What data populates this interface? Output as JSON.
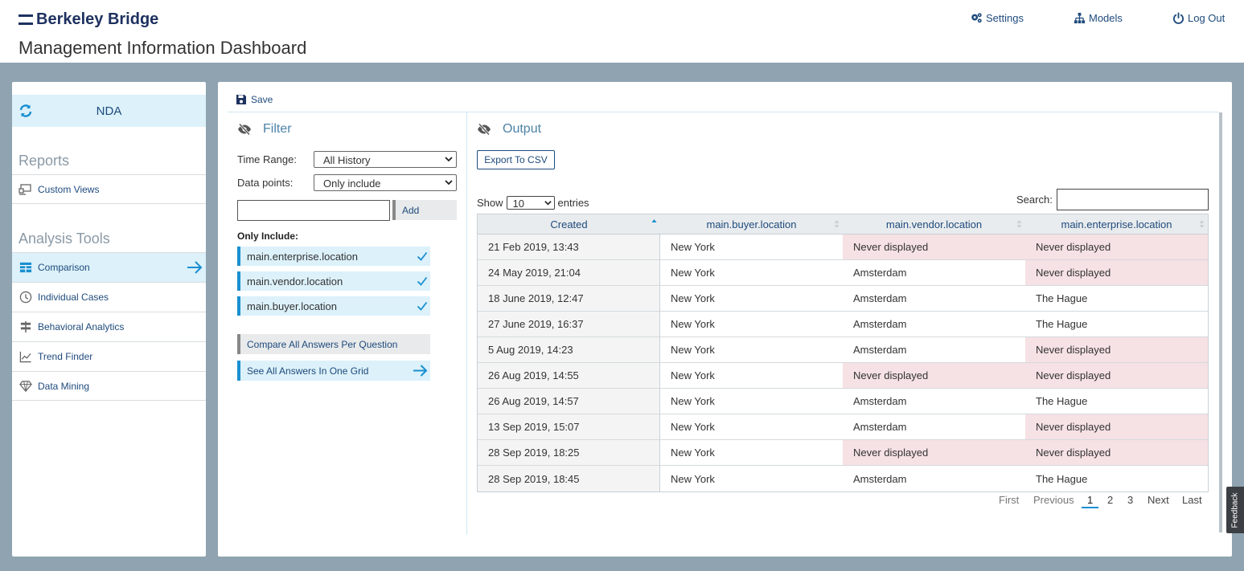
{
  "header": {
    "brand": "Berkeley Bridge",
    "title": "Management Information Dashboard",
    "nav": [
      {
        "label": "Settings",
        "icon": "gears-icon"
      },
      {
        "label": "Models",
        "icon": "sitemap-icon"
      },
      {
        "label": "Log Out",
        "icon": "power-icon"
      }
    ]
  },
  "sidebar": {
    "model": "NDA",
    "reports_title": "Reports",
    "reports": [
      {
        "label": "Custom Views",
        "icon": "custom-views-icon"
      }
    ],
    "tools_title": "Analysis Tools",
    "tools": [
      {
        "label": "Comparison",
        "icon": "table-icon",
        "active": true
      },
      {
        "label": "Individual Cases",
        "icon": "clock-icon"
      },
      {
        "label": "Behavioral Analytics",
        "icon": "signpost-icon"
      },
      {
        "label": "Trend Finder",
        "icon": "chart-line-icon"
      },
      {
        "label": "Data Mining",
        "icon": "diamond-icon"
      }
    ]
  },
  "toolbar": {
    "save_label": "Save"
  },
  "filter": {
    "title": "Filter",
    "time_range_label": "Time Range:",
    "time_range_value": "All History",
    "data_points_label": "Data points:",
    "data_points_value": "Only include",
    "add_input_value": "",
    "add_label": "Add",
    "only_include_label": "Only Include:",
    "included": [
      "main.enterprise.location",
      "main.vendor.location",
      "main.buyer.location"
    ],
    "compare_label": "Compare All Answers Per Question",
    "grid_label": "See All Answers In One Grid"
  },
  "output": {
    "title": "Output",
    "export_label": "Export To CSV",
    "show_label": "Show",
    "show_value": "10",
    "entries_label": "entries",
    "search_label": "Search:",
    "search_value": "",
    "columns": [
      "Created",
      "main.buyer.location",
      "main.vendor.location",
      "main.enterprise.location"
    ],
    "rows": [
      [
        "21 Feb 2019, 13:43",
        "New York",
        "Never displayed",
        "Never displayed"
      ],
      [
        "24 May 2019, 21:04",
        "New York",
        "Amsterdam",
        "Never displayed"
      ],
      [
        "18 June 2019, 12:47",
        "New York",
        "Amsterdam",
        "The Hague"
      ],
      [
        "27 June 2019, 16:37",
        "New York",
        "Amsterdam",
        "The Hague"
      ],
      [
        "5 Aug 2019, 14:23",
        "New York",
        "Amsterdam",
        "Never displayed"
      ],
      [
        "26 Aug 2019, 14:55",
        "New York",
        "Never displayed",
        "Never displayed"
      ],
      [
        "26 Aug 2019, 14:57",
        "New York",
        "Amsterdam",
        "The Hague"
      ],
      [
        "13 Sep 2019, 15:07",
        "New York",
        "Amsterdam",
        "Never displayed"
      ],
      [
        "28 Sep 2019, 18:25",
        "New York",
        "Never displayed",
        "Never displayed"
      ],
      [
        "28 Sep 2019, 18:45",
        "New York",
        "Amsterdam",
        "The Hague"
      ]
    ],
    "pagination": {
      "first": "First",
      "previous": "Previous",
      "pages": [
        "1",
        "2",
        "3"
      ],
      "current": "1",
      "next": "Next",
      "last": "Last"
    }
  },
  "feedback_label": "Feedback",
  "colors": {
    "brand": "#1e3160",
    "link": "#1e4a7c",
    "accent": "#1a8fd1",
    "active_bg": "#dcf1fa",
    "never_displayed_bg": "#f6e1e4",
    "backdrop": "#8fa3b0"
  }
}
